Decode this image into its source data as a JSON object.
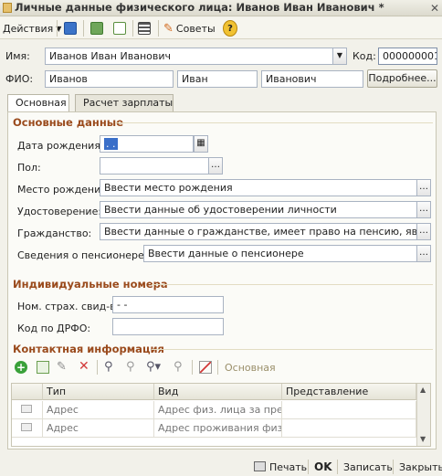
{
  "window": {
    "title": "Личные данные физического лица: Иванов Иван Иванович *"
  },
  "toolbar": {
    "actions": "Действия",
    "sovety": "Советы",
    "help": "?"
  },
  "header": {
    "name_label": "Имя:",
    "name_value": "Иванов Иван Иванович",
    "code_label": "Код:",
    "code_value": "000000001",
    "fio_label": "ФИО:",
    "last_name": "Иванов",
    "first_name": "Иван",
    "middle_name": "Иванович",
    "more_button": "Подробнее..."
  },
  "tabs": [
    {
      "label": "Основная"
    },
    {
      "label": "Расчет зарплаты"
    }
  ],
  "basic": {
    "section": "Основные данные",
    "birth_date_label": "Дата рождения:",
    "birth_date_value": " .  .  ",
    "sex_label": "Пол:",
    "sex_value": "",
    "birth_place_label": "Место рождения:",
    "birth_place_value": "Ввести место рождения",
    "id_label": "Удостоверение:",
    "id_value": "Ввести данные об удостоверении личности",
    "citizenship_label": "Гражданство:",
    "citizenship_value": "Ввести данные о гражданстве, имеет право на пенсию, является н",
    "pension_label": "Сведения о пенсионере:",
    "pension_value": "Ввести данные о пенсионере"
  },
  "individual": {
    "section": "Индивидуальные номера",
    "insurance_label": "Ном. страх. свид-ва:",
    "insurance_value": "-   -",
    "drfo_label": "Код по ДРФО:",
    "drfo_value": ""
  },
  "contacts": {
    "section": "Контактная информация",
    "main_label": "Основная",
    "columns": [
      "Тип",
      "Вид",
      "Представление"
    ],
    "rows": [
      {
        "type": "Адрес",
        "kind": "Адрес физ. лица за пре...",
        "repr": ""
      },
      {
        "type": "Адрес",
        "kind": "Адрес проживания физ....",
        "repr": ""
      }
    ]
  },
  "footer": {
    "print": "Печать",
    "ok": "OK",
    "save": "Записать",
    "close": "Закрыть"
  }
}
